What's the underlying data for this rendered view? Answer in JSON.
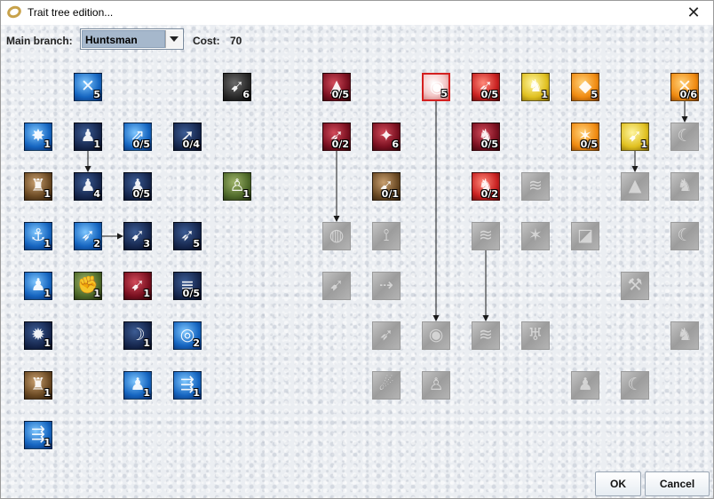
{
  "window": {
    "title": "Trait tree edition..."
  },
  "toolbar": {
    "branch_label": "Main branch:",
    "branch_value": "Huntsman",
    "cost_label": "Cost:",
    "cost_value": "70"
  },
  "buttons": {
    "ok": "OK",
    "cancel": "Cancel"
  },
  "grid": {
    "columns": 14,
    "rows": 8
  },
  "traits": [
    {
      "id": "c1r0",
      "col": 1,
      "row": 0,
      "rank": "5",
      "style": "blue",
      "glyph": "✕",
      "state": "active"
    },
    {
      "id": "c4r0",
      "col": 4,
      "row": 0,
      "rank": "6",
      "style": "dark",
      "glyph": "➹",
      "state": "active"
    },
    {
      "id": "c6r0",
      "col": 6,
      "row": 0,
      "rank": "0/5",
      "style": "crimson",
      "glyph": "▲",
      "state": "active"
    },
    {
      "id": "c8r0",
      "col": 8,
      "row": 0,
      "rank": "5",
      "style": "pink",
      "glyph": "◉",
      "state": "selected"
    },
    {
      "id": "c9r0",
      "col": 9,
      "row": 0,
      "rank": "0/5",
      "style": "red",
      "glyph": "➶",
      "state": "active"
    },
    {
      "id": "c10r0",
      "col": 10,
      "row": 0,
      "rank": "1",
      "style": "yellow",
      "glyph": "♞",
      "state": "active"
    },
    {
      "id": "c11r0",
      "col": 11,
      "row": 0,
      "rank": "5",
      "style": "orange",
      "glyph": "◆",
      "state": "active"
    },
    {
      "id": "c13r0",
      "col": 13,
      "row": 0,
      "rank": "0/6",
      "style": "orange",
      "glyph": "✕",
      "state": "active"
    },
    {
      "id": "c0r1",
      "col": 0,
      "row": 1,
      "rank": "1",
      "style": "blue",
      "glyph": "✸",
      "state": "active"
    },
    {
      "id": "c1r1",
      "col": 1,
      "row": 1,
      "rank": "1",
      "style": "navy",
      "glyph": "♟",
      "state": "active"
    },
    {
      "id": "c2r1",
      "col": 2,
      "row": 1,
      "rank": "0/5",
      "style": "blue",
      "glyph": "⇗",
      "state": "active"
    },
    {
      "id": "c3r1",
      "col": 3,
      "row": 1,
      "rank": "0/4",
      "style": "navy",
      "glyph": "➚",
      "state": "active"
    },
    {
      "id": "c6r1",
      "col": 6,
      "row": 1,
      "rank": "0/2",
      "style": "crimson",
      "glyph": "➶",
      "state": "active"
    },
    {
      "id": "c7r1",
      "col": 7,
      "row": 1,
      "rank": "6",
      "style": "crimson",
      "glyph": "✦",
      "state": "active"
    },
    {
      "id": "c9r1",
      "col": 9,
      "row": 1,
      "rank": "0/5",
      "style": "crimson",
      "glyph": "♞",
      "state": "active"
    },
    {
      "id": "c11r1",
      "col": 11,
      "row": 1,
      "rank": "0/5",
      "style": "orange",
      "glyph": "✶",
      "state": "active"
    },
    {
      "id": "c12r1",
      "col": 12,
      "row": 1,
      "rank": "1",
      "style": "yellow",
      "glyph": "➹",
      "state": "active"
    },
    {
      "id": "c13r1",
      "col": 13,
      "row": 1,
      "rank": "",
      "style": "grey",
      "glyph": "☾",
      "state": "inactive"
    },
    {
      "id": "c0r2",
      "col": 0,
      "row": 2,
      "rank": "1",
      "style": "brown",
      "glyph": "♜",
      "state": "active"
    },
    {
      "id": "c1r2",
      "col": 1,
      "row": 2,
      "rank": "4",
      "style": "navy",
      "glyph": "♟",
      "state": "active"
    },
    {
      "id": "c2r2",
      "col": 2,
      "row": 2,
      "rank": "0/5",
      "style": "navy",
      "glyph": "♟",
      "state": "active"
    },
    {
      "id": "c4r2",
      "col": 4,
      "row": 2,
      "rank": "1",
      "style": "olive",
      "glyph": "♙",
      "state": "active"
    },
    {
      "id": "c7r2",
      "col": 7,
      "row": 2,
      "rank": "0/1",
      "style": "brown",
      "glyph": "➹",
      "state": "active"
    },
    {
      "id": "c9r2",
      "col": 9,
      "row": 2,
      "rank": "0/2",
      "style": "red",
      "glyph": "♞",
      "state": "active"
    },
    {
      "id": "c10r2",
      "col": 10,
      "row": 2,
      "rank": "",
      "style": "grey",
      "glyph": "≋",
      "state": "inactive"
    },
    {
      "id": "c12r2",
      "col": 12,
      "row": 2,
      "rank": "",
      "style": "grey",
      "glyph": "▲",
      "state": "inactive"
    },
    {
      "id": "c13r2",
      "col": 13,
      "row": 2,
      "rank": "",
      "style": "grey",
      "glyph": "♞",
      "state": "inactive"
    },
    {
      "id": "c0r3",
      "col": 0,
      "row": 3,
      "rank": "1",
      "style": "blue",
      "glyph": "⚓",
      "state": "active"
    },
    {
      "id": "c1r3",
      "col": 1,
      "row": 3,
      "rank": "2",
      "style": "blue",
      "glyph": "➶",
      "state": "active"
    },
    {
      "id": "c2r3",
      "col": 2,
      "row": 3,
      "rank": "3",
      "style": "navy",
      "glyph": "➹",
      "state": "active"
    },
    {
      "id": "c3r3",
      "col": 3,
      "row": 3,
      "rank": "5",
      "style": "navy",
      "glyph": "➶",
      "state": "active"
    },
    {
      "id": "c6r3",
      "col": 6,
      "row": 3,
      "rank": "",
      "style": "grey",
      "glyph": "◍",
      "state": "inactive"
    },
    {
      "id": "c7r3",
      "col": 7,
      "row": 3,
      "rank": "",
      "style": "grey",
      "glyph": "⟟",
      "state": "inactive"
    },
    {
      "id": "c9r3",
      "col": 9,
      "row": 3,
      "rank": "",
      "style": "grey",
      "glyph": "≋",
      "state": "inactive"
    },
    {
      "id": "c10r3",
      "col": 10,
      "row": 3,
      "rank": "",
      "style": "grey",
      "glyph": "✶",
      "state": "inactive"
    },
    {
      "id": "c11r3",
      "col": 11,
      "row": 3,
      "rank": "",
      "style": "grey",
      "glyph": "◪",
      "state": "inactive"
    },
    {
      "id": "c13r3",
      "col": 13,
      "row": 3,
      "rank": "",
      "style": "grey",
      "glyph": "☾",
      "state": "inactive"
    },
    {
      "id": "c0r4",
      "col": 0,
      "row": 4,
      "rank": "1",
      "style": "blue",
      "glyph": "♟",
      "state": "active"
    },
    {
      "id": "c1r4",
      "col": 1,
      "row": 4,
      "rank": "1",
      "style": "olive",
      "glyph": "✊",
      "state": "active"
    },
    {
      "id": "c2r4",
      "col": 2,
      "row": 4,
      "rank": "1",
      "style": "crimson",
      "glyph": "➹",
      "state": "active"
    },
    {
      "id": "c3r4",
      "col": 3,
      "row": 4,
      "rank": "0/5",
      "style": "navy",
      "glyph": "≡",
      "state": "active"
    },
    {
      "id": "c6r4",
      "col": 6,
      "row": 4,
      "rank": "",
      "style": "grey",
      "glyph": "➹",
      "state": "inactive"
    },
    {
      "id": "c7r4",
      "col": 7,
      "row": 4,
      "rank": "",
      "style": "grey",
      "glyph": "⇢",
      "state": "inactive"
    },
    {
      "id": "c12r4",
      "col": 12,
      "row": 4,
      "rank": "",
      "style": "grey",
      "glyph": "⚒",
      "state": "inactive"
    },
    {
      "id": "c0r5",
      "col": 0,
      "row": 5,
      "rank": "1",
      "style": "navy",
      "glyph": "✹",
      "state": "active"
    },
    {
      "id": "c2r5",
      "col": 2,
      "row": 5,
      "rank": "1",
      "style": "navy",
      "glyph": "☽",
      "state": "active"
    },
    {
      "id": "c3r5",
      "col": 3,
      "row": 5,
      "rank": "2",
      "style": "blue",
      "glyph": "◎",
      "state": "active"
    },
    {
      "id": "c7r5",
      "col": 7,
      "row": 5,
      "rank": "",
      "style": "grey",
      "glyph": "➶",
      "state": "inactive"
    },
    {
      "id": "c8r5",
      "col": 8,
      "row": 5,
      "rank": "",
      "style": "grey",
      "glyph": "◉",
      "state": "inactive"
    },
    {
      "id": "c9r5",
      "col": 9,
      "row": 5,
      "rank": "",
      "style": "grey",
      "glyph": "≋",
      "state": "inactive"
    },
    {
      "id": "c10r5",
      "col": 10,
      "row": 5,
      "rank": "",
      "style": "grey",
      "glyph": "♅",
      "state": "inactive"
    },
    {
      "id": "c13r5",
      "col": 13,
      "row": 5,
      "rank": "",
      "style": "grey",
      "glyph": "♞",
      "state": "inactive"
    },
    {
      "id": "c0r6",
      "col": 0,
      "row": 6,
      "rank": "1",
      "style": "brown",
      "glyph": "♜",
      "state": "active"
    },
    {
      "id": "c2r6",
      "col": 2,
      "row": 6,
      "rank": "1",
      "style": "blue",
      "glyph": "♟",
      "state": "active"
    },
    {
      "id": "c3r6",
      "col": 3,
      "row": 6,
      "rank": "1",
      "style": "blue",
      "glyph": "⇶",
      "state": "active"
    },
    {
      "id": "c7r6",
      "col": 7,
      "row": 6,
      "rank": "",
      "style": "grey",
      "glyph": "☄",
      "state": "inactive"
    },
    {
      "id": "c8r6",
      "col": 8,
      "row": 6,
      "rank": "",
      "style": "grey",
      "glyph": "♙",
      "state": "inactive"
    },
    {
      "id": "c11r6",
      "col": 11,
      "row": 6,
      "rank": "",
      "style": "grey",
      "glyph": "♟",
      "state": "inactive"
    },
    {
      "id": "c12r6",
      "col": 12,
      "row": 6,
      "rank": "",
      "style": "grey",
      "glyph": "☾",
      "state": "inactive"
    },
    {
      "id": "c0r7",
      "col": 0,
      "row": 7,
      "rank": "1",
      "style": "blue",
      "glyph": "⇶",
      "state": "active"
    }
  ],
  "links": [
    {
      "from": [
        1,
        1
      ],
      "to": [
        1,
        2
      ]
    },
    {
      "from": [
        1,
        3
      ],
      "to": [
        2,
        3
      ]
    },
    {
      "from": [
        6,
        1
      ],
      "to": [
        6,
        3
      ]
    },
    {
      "from": [
        8,
        0
      ],
      "to": [
        8,
        5
      ]
    },
    {
      "from": [
        9,
        3
      ],
      "to": [
        9,
        5
      ]
    },
    {
      "from": [
        12,
        1
      ],
      "to": [
        12,
        2
      ]
    },
    {
      "from": [
        13,
        0
      ],
      "to": [
        13,
        1
      ]
    }
  ]
}
